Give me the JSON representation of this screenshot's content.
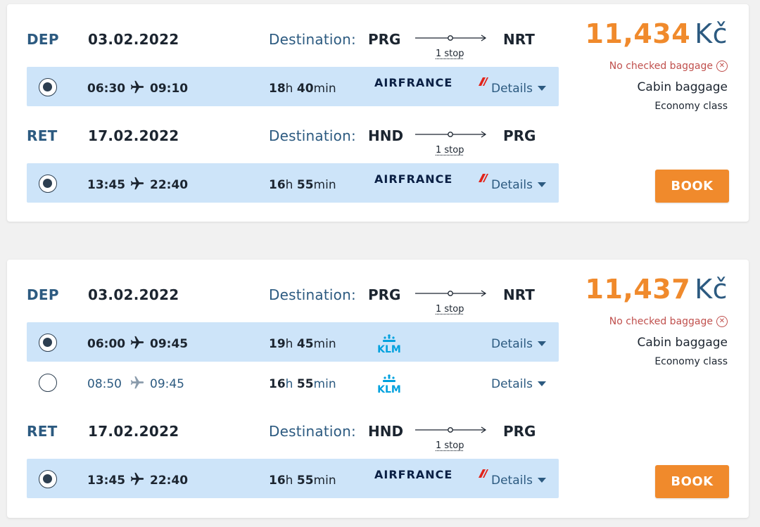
{
  "offers": [
    {
      "price_amount": "11,434",
      "currency": "Kč",
      "baggage_note": "No checked baggage",
      "cabin": "Cabin baggage",
      "class": "Economy class",
      "book_label": "BOOK",
      "legs": [
        {
          "type": "DEP",
          "date": "03.02.2022",
          "destination_label": "Destination:",
          "from": "PRG",
          "to": "NRT",
          "stops": "1 stop",
          "flights": [
            {
              "selected": true,
              "dep": "06:30",
              "arr": "09:10",
              "dur_h": "18",
              "h": "h",
              "dur_m": "40",
              "min": "min",
              "airline": "AIRFRANCE",
              "details": "Details"
            }
          ]
        },
        {
          "type": "RET",
          "date": "17.02.2022",
          "destination_label": "Destination:",
          "from": "HND",
          "to": "PRG",
          "stops": "1 stop",
          "flights": [
            {
              "selected": true,
              "dep": "13:45",
              "arr": "22:40",
              "dur_h": "16",
              "h": "h",
              "dur_m": "55",
              "min": "min",
              "airline": "AIRFRANCE",
              "details": "Details"
            }
          ]
        }
      ]
    },
    {
      "price_amount": "11,437",
      "currency": "Kč",
      "baggage_note": "No checked baggage",
      "cabin": "Cabin baggage",
      "class": "Economy class",
      "book_label": "BOOK",
      "legs": [
        {
          "type": "DEP",
          "date": "03.02.2022",
          "destination_label": "Destination:",
          "from": "PRG",
          "to": "NRT",
          "stops": "1 stop",
          "flights": [
            {
              "selected": true,
              "dep": "06:00",
              "arr": "09:45",
              "dur_h": "19",
              "h": "h",
              "dur_m": "45",
              "min": "min",
              "airline": "KLM",
              "details": "Details"
            },
            {
              "selected": false,
              "dep": "08:50",
              "arr": "09:45",
              "dur_h": "16",
              "h": "h",
              "dur_m": "55",
              "min": "min",
              "airline": "KLM",
              "details": "Details"
            }
          ]
        },
        {
          "type": "RET",
          "date": "17.02.2022",
          "destination_label": "Destination:",
          "from": "HND",
          "to": "PRG",
          "stops": "1 stop",
          "flights": [
            {
              "selected": true,
              "dep": "13:45",
              "arr": "22:40",
              "dur_h": "16",
              "h": "h",
              "dur_m": "55",
              "min": "min",
              "airline": "AIRFRANCE",
              "details": "Details"
            }
          ]
        }
      ]
    }
  ],
  "colors": {
    "accent_orange": "#f08a2c",
    "label_blue": "#2c5a80",
    "selected_row": "#cde4f9",
    "warning_red": "#c0504d",
    "klm_blue": "#00a1de",
    "af_red": "#e2231a",
    "af_navy": "#0a1f44"
  },
  "icons": [
    "plane-icon",
    "radio-icon",
    "chevron-down-icon",
    "close-circle-icon",
    "route-arrow-icon",
    "airfrance-logo",
    "klm-logo"
  ]
}
